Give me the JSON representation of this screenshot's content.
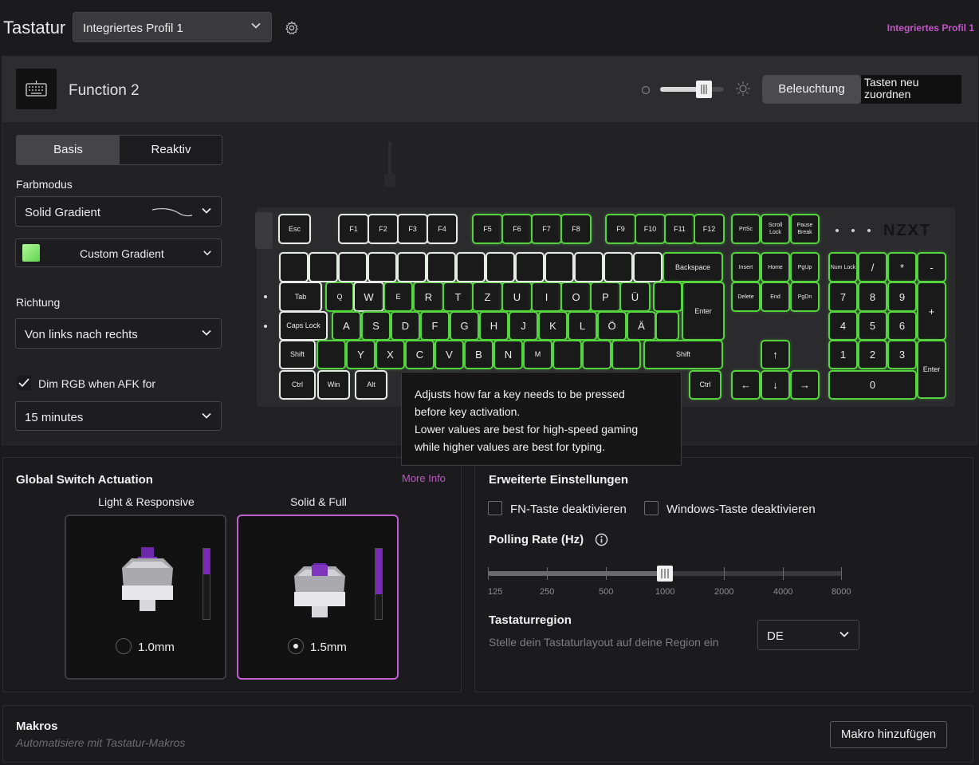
{
  "header": {
    "title": "Tastatur",
    "profile_selected": "Integriertes Profil 1",
    "profile_right": "Integriertes Profil 1"
  },
  "lighting": {
    "mode_name": "Function 2",
    "brightness_fraction": 0.68,
    "btn_lighting": "Beleuchtung",
    "btn_remap": "Tasten neu zuordnen",
    "tabs": [
      "Basis",
      "Reaktiv"
    ],
    "color_mode_label": "Farbmodus",
    "color_mode_value": "Solid Gradient",
    "gradient_value": "Custom Gradient",
    "direction_label": "Richtung",
    "direction_value": "Von links nach rechts",
    "dim_label": "Dim RGB when AFK for",
    "dim_value": "15 minutes",
    "gradient_color": "#7fe86a",
    "key_glow_color": "#55d43f",
    "logo": "NZXT"
  },
  "keyboard": {
    "keys": [
      [
        "Esc",
        "F1",
        "F2",
        "F3",
        "F4",
        "F5",
        "F6",
        "F7",
        "F8",
        "F9",
        "F10",
        "F11",
        "F12",
        "PrtSc",
        "Scroll Lock",
        "Pause Break"
      ],
      [
        "Backspace",
        "Insert",
        "Home",
        "PgUp",
        "Num Lock",
        "/",
        "*",
        "-"
      ],
      [
        "Tab",
        "Q",
        "W",
        "E",
        "R",
        "T",
        "Z",
        "U",
        "I",
        "O",
        "P",
        "Ü",
        "Enter",
        "Delete",
        "End",
        "PgDn",
        "7",
        "8",
        "9",
        "+"
      ],
      [
        "Caps Lock",
        "A",
        "S",
        "D",
        "F",
        "G",
        "H",
        "J",
        "K",
        "L",
        "Ö",
        "Ä",
        "4",
        "5",
        "6"
      ],
      [
        "Shift",
        "Y",
        "X",
        "C",
        "V",
        "B",
        "N",
        "M",
        "Shift",
        "↑",
        "1",
        "2",
        "3",
        "Enter"
      ],
      [
        "Ctrl",
        "Win",
        "Alt",
        "Ctrl",
        "←",
        "↓",
        "→",
        "0"
      ]
    ]
  },
  "tooltip": {
    "line1": "Adjusts how far a key needs to be pressed",
    "line2": "before key activation.",
    "line3": "Lower values are best for high-speed gaming",
    "line4": "while higher values are best for typing."
  },
  "actuation": {
    "title": "Global Switch Actuation",
    "more_info": "More Info",
    "options": [
      {
        "label": "Light & Responsive",
        "value": "1.0mm",
        "selected": false,
        "level": 0.35
      },
      {
        "label": "Solid & Full",
        "value": "1.5mm",
        "selected": true,
        "level": 0.55
      }
    ],
    "accent": "#c15fd1"
  },
  "advanced": {
    "title": "Erweiterte Einstellungen",
    "fn_label": "FN-Taste deaktivieren",
    "win_label": "Windows-Taste deaktivieren",
    "polling_title": "Polling Rate (Hz)",
    "polling_options": [
      "125",
      "250",
      "500",
      "1000",
      "2000",
      "4000",
      "8000"
    ],
    "polling_selected": "1000",
    "region_title": "Tastaturregion",
    "region_sub": "Stelle dein Tastaturlayout auf deine Region ein",
    "region_value": "DE"
  },
  "macros": {
    "title": "Makros",
    "subtitle": "Automatisiere mit Tastatur-Makros",
    "add_button": "Makro hinzufügen"
  }
}
